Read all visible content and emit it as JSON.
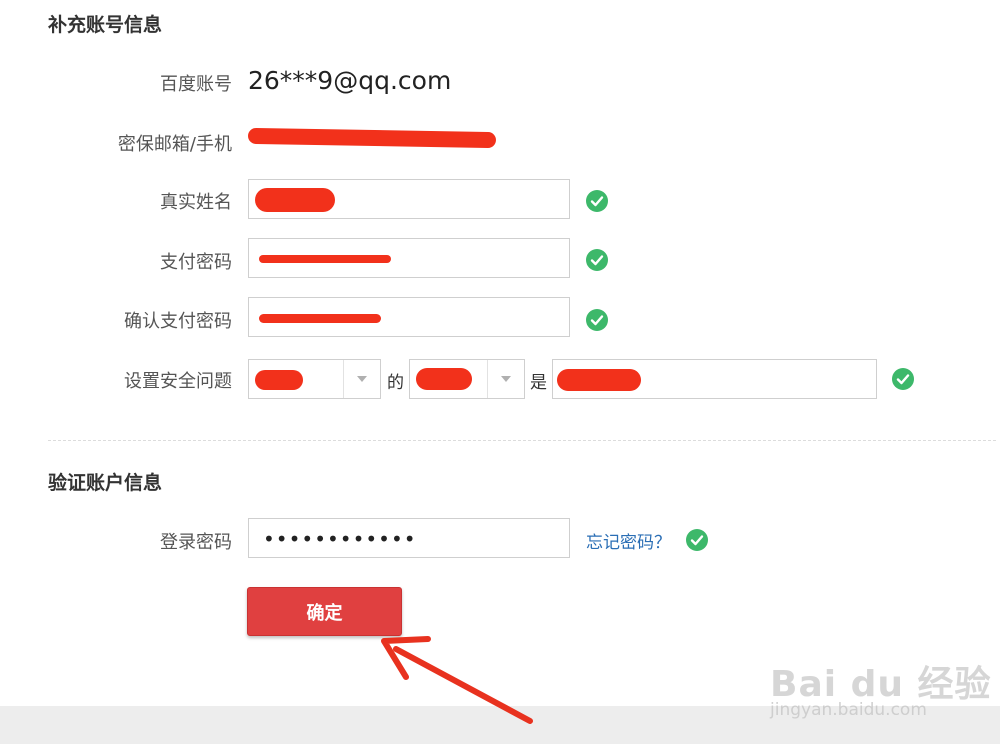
{
  "section1": {
    "title": "补充账号信息"
  },
  "rows": {
    "account": {
      "label": "百度账号",
      "value": "26***9@qq.com"
    },
    "security": {
      "label": "密保邮箱/手机"
    },
    "realname": {
      "label": "真实姓名"
    },
    "paypwd": {
      "label": "支付密码"
    },
    "paypwd_confirm": {
      "label": "确认支付密码"
    },
    "question": {
      "label": "设置安全问题",
      "joiner_of": "的",
      "joiner_is": "是"
    }
  },
  "section2": {
    "title": "验证账户信息"
  },
  "login": {
    "label": "登录密码",
    "value": "••••••••••••",
    "forgot_link": "忘记密码？"
  },
  "confirm_button": "确定",
  "watermark": {
    "brand": "Bai du 经验",
    "url": "jingyan.baidu.com"
  },
  "colors": {
    "check": "#3db86a",
    "button": "#e04040",
    "link": "#2a6eb5",
    "redaction": "#f2311b",
    "annotation_arrow": "#e8321f"
  },
  "icons": {
    "valid": "check-circle-icon",
    "dropdown": "chevron-down-icon",
    "annotation": "arrow-annotation-icon"
  }
}
